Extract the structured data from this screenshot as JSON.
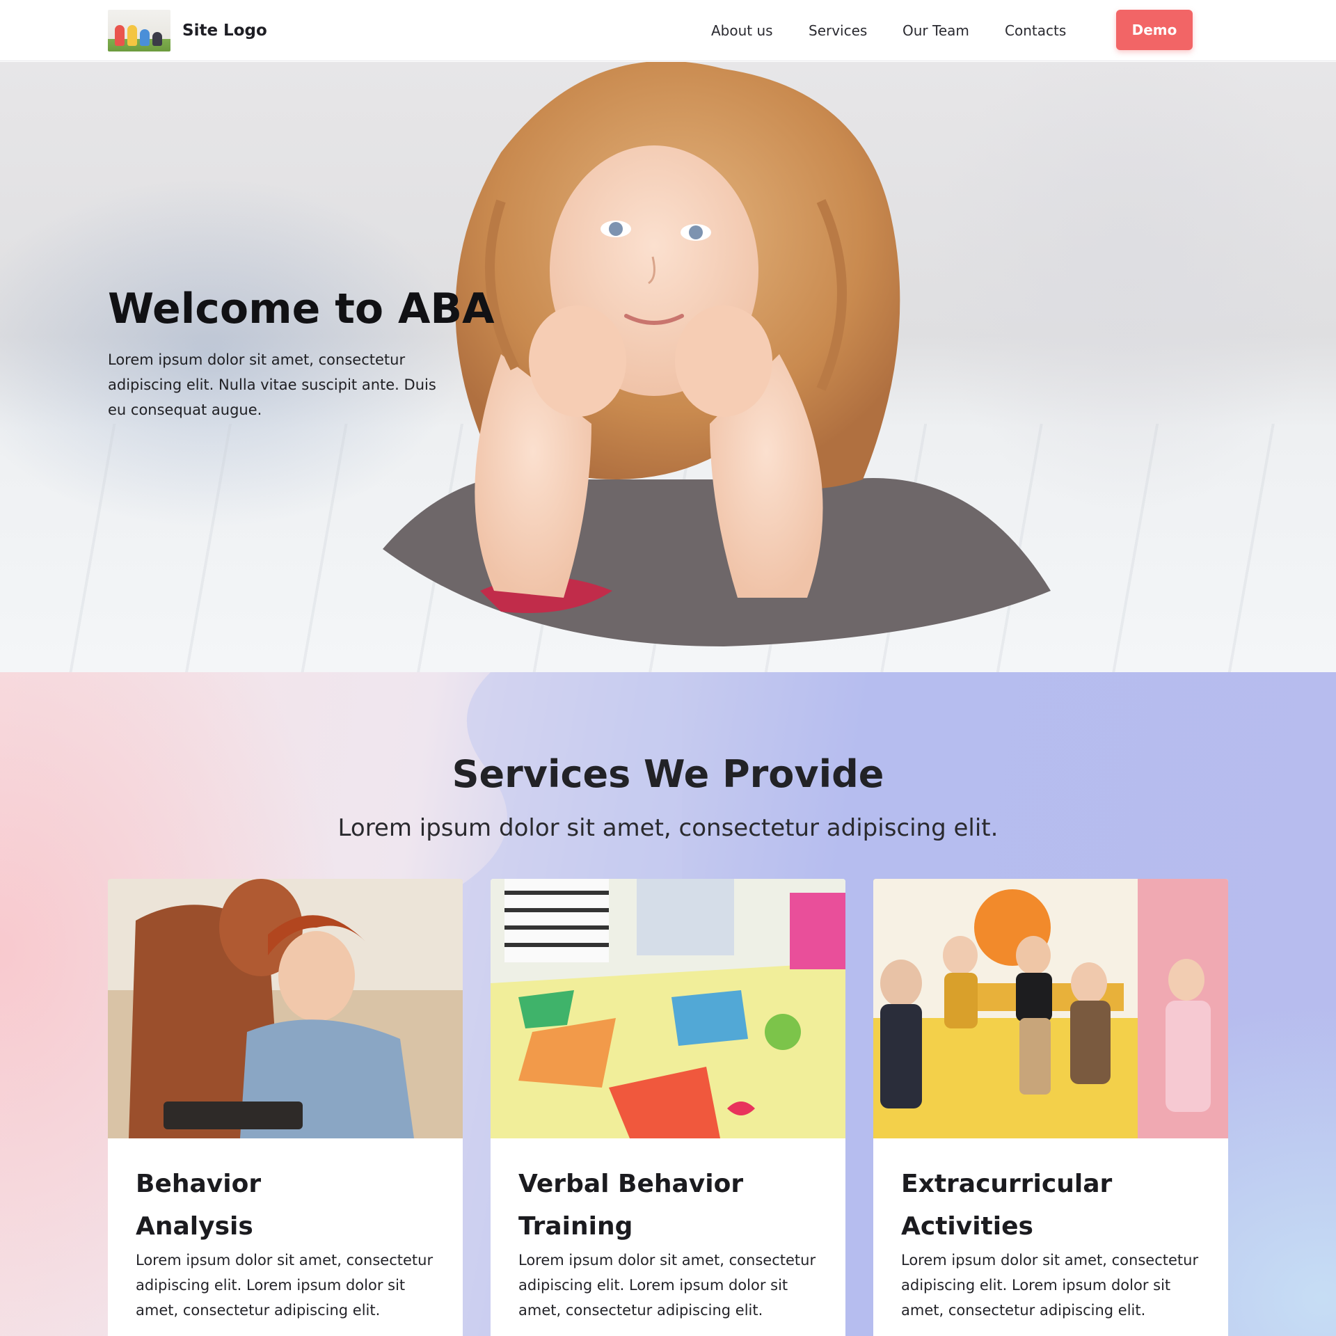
{
  "header": {
    "logo_text": "Site Logo",
    "nav": [
      "About us",
      "Services",
      "Our Team",
      "Contacts"
    ],
    "demo_label": "Demo"
  },
  "hero": {
    "title": "Welcome to ABA",
    "text": "Lorem ipsum dolor sit amet, consectetur adipiscing elit. Nulla vitae suscipit ante. Duis eu consequat augue."
  },
  "services": {
    "title": "Services We Provide",
    "subtitle": "Lorem ipsum dolor sit amet, consectetur adipiscing elit.",
    "cards": [
      {
        "title_line1": "Behavior",
        "title_line2": "Analysis",
        "text": "Lorem ipsum dolor sit amet, consectetur adipiscing elit. Lorem ipsum dolor sit amet, consectetur adipiscing elit."
      },
      {
        "title_line1": "Verbal Behavior",
        "title_line2": "Training",
        "text": "Lorem ipsum dolor sit amet, consectetur adipiscing elit. Lorem ipsum dolor sit amet, consectetur adipiscing elit."
      },
      {
        "title_line1": "Extracurricular",
        "title_line2": "Activities",
        "text": "Lorem ipsum dolor sit amet, consectetur adipiscing elit. Lorem ipsum dolor sit amet, consectetur adipiscing elit."
      }
    ]
  },
  "colors": {
    "accent": "#f26566",
    "text": "#1e1e24"
  }
}
